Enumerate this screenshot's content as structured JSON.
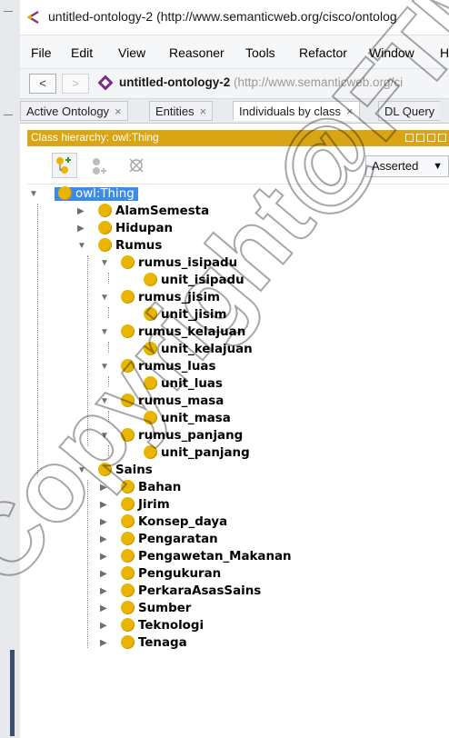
{
  "window": {
    "title": "untitled-ontology-2 (http://www.semanticweb.org/cisco/ontolog"
  },
  "menubar": [
    "File",
    "Edit",
    "View",
    "Reasoner",
    "Tools",
    "Refactor",
    "Window",
    "H"
  ],
  "address": {
    "back_label": "<",
    "forward_label": ">",
    "name": "untitled-ontology-2",
    "uri": "(http://www.semanticweb.org/ci"
  },
  "tabs": [
    {
      "label": "Active Ontology",
      "close": "×"
    },
    {
      "label": "Entities",
      "close": "×"
    },
    {
      "label": "Individuals by class",
      "close": "×",
      "active": true
    },
    {
      "label": "DL Query",
      "close": ""
    }
  ],
  "panel": {
    "title": "Class hierarchy: owl:Thing",
    "mode": "Asserted"
  },
  "tree": {
    "root": "owl:Thing",
    "children": [
      {
        "label": "AlamSemesta"
      },
      {
        "label": "Hidupan"
      },
      {
        "label": "Rumus"
      },
      {
        "label": "rumus_isipadu"
      },
      {
        "label": "unit_isipadu"
      },
      {
        "label": "rumus_jisim"
      },
      {
        "label": "unit_jisim"
      },
      {
        "label": "rumus_kelajuan"
      },
      {
        "label": "unit_kelajuan"
      },
      {
        "label": "rumus_luas"
      },
      {
        "label": "unit_luas"
      },
      {
        "label": "rumus_masa"
      },
      {
        "label": "unit_masa"
      },
      {
        "label": "rumus_panjang"
      },
      {
        "label": "unit_panjang"
      },
      {
        "label": "Sains"
      },
      {
        "label": "Bahan"
      },
      {
        "label": "Jirim"
      },
      {
        "label": "Konsep_daya"
      },
      {
        "label": "Pengaratan"
      },
      {
        "label": "Pengawetan_Makanan"
      },
      {
        "label": "Pengukuran"
      },
      {
        "label": "PerkaraAsasSains"
      },
      {
        "label": "Sumber"
      },
      {
        "label": "Teknologi"
      },
      {
        "label": "Tenaga"
      }
    ]
  },
  "watermark": {
    "text": "Copyright@FTMK",
    "color": "#000000"
  },
  "colors": {
    "panel_header": "#d9a514",
    "class_dot": "#e9b500",
    "selection": "#3c8be8"
  }
}
